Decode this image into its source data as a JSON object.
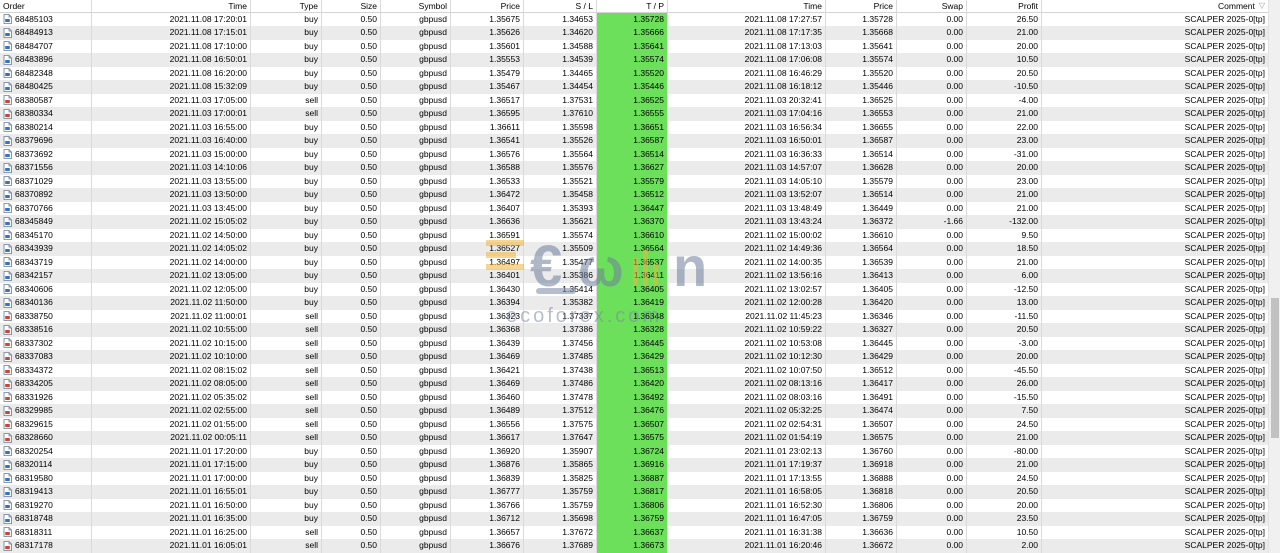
{
  "headers": {
    "order": "Order",
    "time": "Time",
    "type": "Type",
    "size": "Size",
    "symbol": "Symbol",
    "price": "Price",
    "sl": "S / L",
    "tp": "T / P",
    "close_time": "Time",
    "close_price": "Price",
    "swap": "Swap",
    "profit": "Profit",
    "comment": "Comment"
  },
  "watermark": {
    "text": "ecoforex.com"
  },
  "colors": {
    "tp_fill": "#6ce05a",
    "alt_row": "#ebebeb"
  },
  "rows": [
    [
      "68485103",
      "2021.11.08 17:20:01",
      "buy",
      "0.50",
      "gbpusd",
      "1.35675",
      "1.34653",
      "1.35728",
      "2021.11.08 17:27:57",
      "1.35728",
      "0.00",
      "26.50",
      "SCALPER 2025-0[tp]"
    ],
    [
      "68484913",
      "2021.11.08 17:15:01",
      "buy",
      "0.50",
      "gbpusd",
      "1.35626",
      "1.34620",
      "1.35666",
      "2021.11.08 17:17:35",
      "1.35668",
      "0.00",
      "21.00",
      "SCALPER 2025-0[tp]"
    ],
    [
      "68484707",
      "2021.11.08 17:10:00",
      "buy",
      "0.50",
      "gbpusd",
      "1.35601",
      "1.34588",
      "1.35641",
      "2021.11.08 17:13:03",
      "1.35641",
      "0.00",
      "20.00",
      "SCALPER 2025-0[tp]"
    ],
    [
      "68483896",
      "2021.11.08 16:50:01",
      "buy",
      "0.50",
      "gbpusd",
      "1.35553",
      "1.34539",
      "1.35574",
      "2021.11.08 17:06:08",
      "1.35574",
      "0.00",
      "10.50",
      "SCALPER 2025-0[tp]"
    ],
    [
      "68482348",
      "2021.11.08 16:20:00",
      "buy",
      "0.50",
      "gbpusd",
      "1.35479",
      "1.34465",
      "1.35520",
      "2021.11.08 16:46:29",
      "1.35520",
      "0.00",
      "20.50",
      "SCALPER 2025-0[tp]"
    ],
    [
      "68480425",
      "2021.11.08 15:32:09",
      "buy",
      "0.50",
      "gbpusd",
      "1.35467",
      "1.34454",
      "1.35446",
      "2021.11.08 16:18:12",
      "1.35446",
      "0.00",
      "-10.50",
      "SCALPER 2025-0[tp]"
    ],
    [
      "68380587",
      "2021.11.03 17:05:00",
      "sell",
      "0.50",
      "gbpusd",
      "1.36517",
      "1.37531",
      "1.36525",
      "2021.11.03 20:32:41",
      "1.36525",
      "0.00",
      "-4.00",
      "SCALPER 2025-0[tp]"
    ],
    [
      "68380334",
      "2021.11.03 17:00:01",
      "sell",
      "0.50",
      "gbpusd",
      "1.36595",
      "1.37610",
      "1.36555",
      "2021.11.03 17:04:16",
      "1.36553",
      "0.00",
      "21.00",
      "SCALPER 2025-0[tp]"
    ],
    [
      "68380214",
      "2021.11.03 16:55:00",
      "buy",
      "0.50",
      "gbpusd",
      "1.36611",
      "1.35598",
      "1.36651",
      "2021.11.03 16:56:34",
      "1.36655",
      "0.00",
      "22.00",
      "SCALPER 2025-0[tp]"
    ],
    [
      "68379696",
      "2021.11.03 16:40:00",
      "buy",
      "0.50",
      "gbpusd",
      "1.36541",
      "1.35526",
      "1.36587",
      "2021.11.03 16:50:01",
      "1.36587",
      "0.00",
      "23.00",
      "SCALPER 2025-0[tp]"
    ],
    [
      "68373692",
      "2021.11.03 15:00:00",
      "buy",
      "0.50",
      "gbpusd",
      "1.36576",
      "1.35564",
      "1.36514",
      "2021.11.03 16:36:33",
      "1.36514",
      "0.00",
      "-31.00",
      "SCALPER 2025-0[tp]"
    ],
    [
      "68371556",
      "2021.11.03 14:10:06",
      "buy",
      "0.50",
      "gbpusd",
      "1.36588",
      "1.35576",
      "1.36627",
      "2021.11.03 14:57:07",
      "1.36628",
      "0.00",
      "20.00",
      "SCALPER 2025-0[tp]"
    ],
    [
      "68371029",
      "2021.11.03 13:55:00",
      "buy",
      "0.50",
      "gbpusd",
      "1.36533",
      "1.35521",
      "1.35579",
      "2021.11.03 14:05:10",
      "1.35579",
      "0.00",
      "23.00",
      "SCALPER 2025-0[tp]"
    ],
    [
      "68370892",
      "2021.11.03 13:50:00",
      "buy",
      "0.50",
      "gbpusd",
      "1.36472",
      "1.35458",
      "1.36512",
      "2021.11.03 13:52:07",
      "1.36514",
      "0.00",
      "21.00",
      "SCALPER 2025-0[tp]"
    ],
    [
      "68370766",
      "2021.11.03 13:45:00",
      "buy",
      "0.50",
      "gbpusd",
      "1.36407",
      "1.35393",
      "1.36447",
      "2021.11.03 13:48:49",
      "1.36449",
      "0.00",
      "21.00",
      "SCALPER 2025-0[tp]"
    ],
    [
      "68345849",
      "2021.11.02 15:05:02",
      "buy",
      "0.50",
      "gbpusd",
      "1.36636",
      "1.35621",
      "1.36370",
      "2021.11.03 13:43:24",
      "1.36372",
      "-1.66",
      "-132.00",
      "SCALPER 2025-0[tp]"
    ],
    [
      "68345170",
      "2021.11.02 14:50:00",
      "buy",
      "0.50",
      "gbpusd",
      "1.36591",
      "1.35574",
      "1.36610",
      "2021.11.02 15:00:02",
      "1.36610",
      "0.00",
      "9.50",
      "SCALPER 2025-0[tp]"
    ],
    [
      "68343939",
      "2021.11.02 14:05:02",
      "buy",
      "0.50",
      "gbpusd",
      "1.36527",
      "1.35509",
      "1.36564",
      "2021.11.02 14:49:36",
      "1.36564",
      "0.00",
      "18.50",
      "SCALPER 2025-0[tp]"
    ],
    [
      "68343719",
      "2021.11.02 14:00:00",
      "buy",
      "0.50",
      "gbpusd",
      "1.36497",
      "1.35477",
      "1.36537",
      "2021.11.02 14:00:35",
      "1.36539",
      "0.00",
      "21.00",
      "SCALPER 2025-0[tp]"
    ],
    [
      "68342157",
      "2021.11.02 13:05:00",
      "buy",
      "0.50",
      "gbpusd",
      "1.36401",
      "1.35386",
      "1.36411",
      "2021.11.02 13:56:16",
      "1.36413",
      "0.00",
      "6.00",
      "SCALPER 2025-0[tp]"
    ],
    [
      "68340606",
      "2021.11.02 12:05:00",
      "buy",
      "0.50",
      "gbpusd",
      "1.36430",
      "1.35414",
      "1.36405",
      "2021.11.02 13:02:57",
      "1.36405",
      "0.00",
      "-12.50",
      "SCALPER 2025-0[tp]"
    ],
    [
      "68340136",
      "2021.11.02 11:50:00",
      "buy",
      "0.50",
      "gbpusd",
      "1.36394",
      "1.35382",
      "1.36419",
      "2021.11.02 12:00:28",
      "1.36420",
      "0.00",
      "13.00",
      "SCALPER 2025-0[tp]"
    ],
    [
      "68338750",
      "2021.11.02 11:00:01",
      "sell",
      "0.50",
      "gbpusd",
      "1.36323",
      "1.37337",
      "1.36348",
      "2021.11.02 11:45:23",
      "1.36346",
      "0.00",
      "-11.50",
      "SCALPER 2025-0[tp]"
    ],
    [
      "68338516",
      "2021.11.02 10:55:00",
      "sell",
      "0.50",
      "gbpusd",
      "1.36368",
      "1.37386",
      "1.36328",
      "2021.11.02 10:59:22",
      "1.36327",
      "0.00",
      "20.50",
      "SCALPER 2025-0[tp]"
    ],
    [
      "68337302",
      "2021.11.02 10:15:00",
      "sell",
      "0.50",
      "gbpusd",
      "1.36439",
      "1.37456",
      "1.36445",
      "2021.11.02 10:53:08",
      "1.36445",
      "0.00",
      "-3.00",
      "SCALPER 2025-0[tp]"
    ],
    [
      "68337083",
      "2021.11.02 10:10:00",
      "sell",
      "0.50",
      "gbpusd",
      "1.36469",
      "1.37485",
      "1.36429",
      "2021.11.02 10:12:30",
      "1.36429",
      "0.00",
      "20.00",
      "SCALPER 2025-0[tp]"
    ],
    [
      "68334372",
      "2021.11.02 08:15:02",
      "sell",
      "0.50",
      "gbpusd",
      "1.36421",
      "1.37438",
      "1.36513",
      "2021.11.02 10:07:50",
      "1.36512",
      "0.00",
      "-45.50",
      "SCALPER 2025-0[tp]"
    ],
    [
      "68334205",
      "2021.11.02 08:05:00",
      "sell",
      "0.50",
      "gbpusd",
      "1.36469",
      "1.37486",
      "1.36420",
      "2021.11.02 08:13:16",
      "1.36417",
      "0.00",
      "26.00",
      "SCALPER 2025-0[tp]"
    ],
    [
      "68331926",
      "2021.11.02 05:35:02",
      "sell",
      "0.50",
      "gbpusd",
      "1.36460",
      "1.37478",
      "1.36492",
      "2021.11.02 08:03:16",
      "1.36491",
      "0.00",
      "-15.50",
      "SCALPER 2025-0[tp]"
    ],
    [
      "68329985",
      "2021.11.02 02:55:00",
      "sell",
      "0.50",
      "gbpusd",
      "1.36489",
      "1.37512",
      "1.36476",
      "2021.11.02 05:32:25",
      "1.36474",
      "0.00",
      "7.50",
      "SCALPER 2025-0[tp]"
    ],
    [
      "68329615",
      "2021.11.02 01:55:00",
      "sell",
      "0.50",
      "gbpusd",
      "1.36556",
      "1.37575",
      "1.36507",
      "2021.11.02 02:54:31",
      "1.36507",
      "0.00",
      "24.50",
      "SCALPER 2025-0[tp]"
    ],
    [
      "68328660",
      "2021.11.02 00:05:11",
      "sell",
      "0.50",
      "gbpusd",
      "1.36617",
      "1.37647",
      "1.36575",
      "2021.11.02 01:54:19",
      "1.36575",
      "0.00",
      "21.00",
      "SCALPER 2025-0[tp]"
    ],
    [
      "68320254",
      "2021.11.01 17:20:00",
      "buy",
      "0.50",
      "gbpusd",
      "1.36920",
      "1.35907",
      "1.36724",
      "2021.11.01 23:02:13",
      "1.36760",
      "0.00",
      "-80.00",
      "SCALPER 2025-0[tp]"
    ],
    [
      "68320114",
      "2021.11.01 17:15:00",
      "buy",
      "0.50",
      "gbpusd",
      "1.36876",
      "1.35865",
      "1.36916",
      "2021.11.01 17:19:37",
      "1.36918",
      "0.00",
      "21.00",
      "SCALPER 2025-0[tp]"
    ],
    [
      "68319580",
      "2021.11.01 17:00:00",
      "buy",
      "0.50",
      "gbpusd",
      "1.36839",
      "1.35825",
      "1.36887",
      "2021.11.01 17:13:55",
      "1.36888",
      "0.00",
      "24.50",
      "SCALPER 2025-0[tp]"
    ],
    [
      "68319413",
      "2021.11.01 16:55:01",
      "buy",
      "0.50",
      "gbpusd",
      "1.36777",
      "1.35759",
      "1.36817",
      "2021.11.01 16:58:05",
      "1.36818",
      "0.00",
      "20.50",
      "SCALPER 2025-0[tp]"
    ],
    [
      "68319270",
      "2021.11.01 16:50:00",
      "buy",
      "0.50",
      "gbpusd",
      "1.36766",
      "1.35759",
      "1.36806",
      "2021.11.01 16:52:30",
      "1.36806",
      "0.00",
      "20.00",
      "SCALPER 2025-0[tp]"
    ],
    [
      "68318748",
      "2021.11.01 16:35:00",
      "buy",
      "0.50",
      "gbpusd",
      "1.36712",
      "1.35698",
      "1.36759",
      "2021.11.01 16:47:05",
      "1.36759",
      "0.00",
      "23.50",
      "SCALPER 2025-0[tp]"
    ],
    [
      "68318311",
      "2021.11.01 16:25:00",
      "sell",
      "0.50",
      "gbpusd",
      "1.36657",
      "1.37672",
      "1.36637",
      "2021.11.01 16:31:38",
      "1.36636",
      "0.00",
      "10.50",
      "SCALPER 2025-0[tp]"
    ],
    [
      "68317178",
      "2021.11.01 16:05:01",
      "sell",
      "0.50",
      "gbpusd",
      "1.36676",
      "1.37689",
      "1.36673",
      "2021.11.01 16:20:46",
      "1.36672",
      "0.00",
      "2.00",
      "SCALPER 2025-0[tp]"
    ]
  ]
}
